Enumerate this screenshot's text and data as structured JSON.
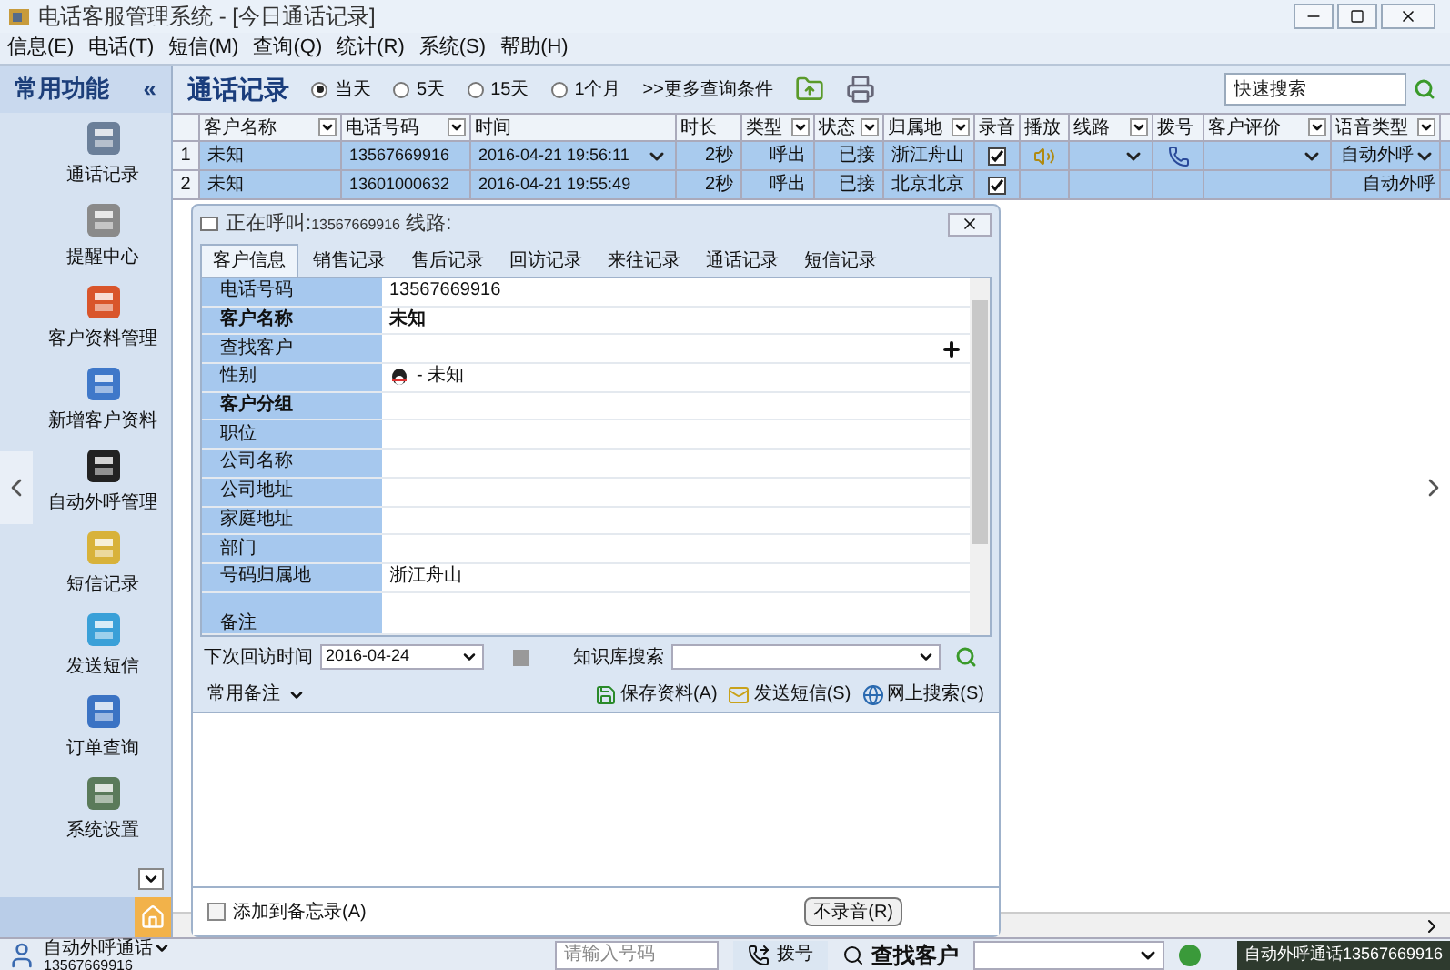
{
  "window": {
    "title": "电话客服管理系统 - [今日通话记录]"
  },
  "menu": [
    "信息(E)",
    "电话(T)",
    "短信(M)",
    "查询(Q)",
    "统计(R)",
    "系统(S)",
    "帮助(H)"
  ],
  "sidebar": {
    "title": "常用功能",
    "collapse": "«",
    "items": [
      {
        "label": "通话记录"
      },
      {
        "label": "提醒中心"
      },
      {
        "label": "客户资料管理"
      },
      {
        "label": "新增客户资料"
      },
      {
        "label": "自动外呼管理"
      },
      {
        "label": "短信记录"
      },
      {
        "label": "发送短信"
      },
      {
        "label": "订单查询"
      },
      {
        "label": "系统设置"
      }
    ]
  },
  "header": {
    "title": "通话记录",
    "ranges": [
      {
        "label": "当天",
        "selected": true
      },
      {
        "label": "5天",
        "selected": false
      },
      {
        "label": "15天",
        "selected": false
      },
      {
        "label": "1个月",
        "selected": false
      }
    ],
    "more": ">>更多查询条件",
    "search": {
      "placeholder": "快速搜索"
    }
  },
  "table": {
    "columns": [
      {
        "label": "客户名称",
        "filter": true
      },
      {
        "label": "电话号码",
        "filter": true
      },
      {
        "label": "时间",
        "filter": false
      },
      {
        "label": "时长",
        "filter": false
      },
      {
        "label": "类型",
        "filter": true
      },
      {
        "label": "状态",
        "filter": true
      },
      {
        "label": "归属地",
        "filter": true
      },
      {
        "label": "录音",
        "filter": false
      },
      {
        "label": "播放",
        "filter": false
      },
      {
        "label": "线路",
        "filter": true
      },
      {
        "label": "拨号",
        "filter": false
      },
      {
        "label": "客户评价",
        "filter": true
      },
      {
        "label": "语音类型",
        "filter": true
      }
    ],
    "rows": [
      {
        "num": "1",
        "name": "未知",
        "phone": "13567669916",
        "time": "2016-04-21 19:56:11",
        "duration": "2秒",
        "type": "呼出",
        "status": "已接",
        "location": "浙江舟山",
        "recorded": true,
        "editing": true,
        "voice": "自动外呼"
      },
      {
        "num": "2",
        "name": "未知",
        "phone": "13601000632",
        "time": "2016-04-21 19:55:49",
        "duration": "2秒",
        "type": "呼出",
        "status": "已接",
        "location": "北京北京",
        "recorded": true,
        "editing": false,
        "voice": "自动外呼"
      }
    ]
  },
  "dialog": {
    "title": "正在呼叫:",
    "number": "13567669916",
    "line": "线路:",
    "tabs": [
      {
        "label": "客户信息",
        "selected": true
      },
      {
        "label": "销售记录",
        "selected": false
      },
      {
        "label": "售后记录",
        "selected": false
      },
      {
        "label": "回访记录",
        "selected": false
      },
      {
        "label": "来往记录",
        "selected": false
      },
      {
        "label": "通话记录",
        "selected": false
      },
      {
        "label": "短信记录",
        "selected": false
      }
    ],
    "fields": [
      {
        "label": "电话号码",
        "value": "13567669916",
        "bold": false,
        "kind": "text"
      },
      {
        "label": "客户名称",
        "value": "未知",
        "bold": true,
        "kind": "text"
      },
      {
        "label": "查找客户",
        "bold": false,
        "kind": "lookup"
      },
      {
        "label": "性别",
        "value": "- 未知",
        "bold": false,
        "kind": "gender"
      },
      {
        "label": "客户分组",
        "bold": true,
        "kind": "text"
      },
      {
        "label": "职位",
        "bold": false,
        "kind": "text"
      },
      {
        "label": "公司名称",
        "bold": false,
        "kind": "text"
      },
      {
        "label": "公司地址",
        "bold": false,
        "kind": "text"
      },
      {
        "label": "家庭地址",
        "bold": false,
        "kind": "text"
      },
      {
        "label": "部门",
        "bold": false,
        "kind": "text"
      },
      {
        "label": "号码归属地",
        "value": "浙江舟山",
        "bold": false,
        "kind": "text"
      },
      {
        "label": "备注",
        "bold": false,
        "kind": "memo"
      }
    ],
    "next_visit": {
      "label": "下次回访时间",
      "value": "2016-04-24"
    },
    "kb_search": {
      "label": "知识库搜索"
    },
    "notes_menu": "常用备注",
    "actions": [
      {
        "label": "保存资料(A)",
        "kind": "save"
      },
      {
        "label": "发送短信(S)",
        "kind": "sms"
      },
      {
        "label": "网上搜索(S)",
        "kind": "web"
      }
    ],
    "memo_checkbox": {
      "label": "添加到备忘录(A)",
      "checked": false
    },
    "no_record_button": "不录音(R)"
  },
  "status_bar": {
    "mode": "自动外呼通话",
    "mode_number": "13567669916",
    "phone_input": {
      "placeholder": "请输入号码"
    },
    "dial": "拨号",
    "find": "查找客户",
    "current": "自动外呼通话13567669916"
  }
}
